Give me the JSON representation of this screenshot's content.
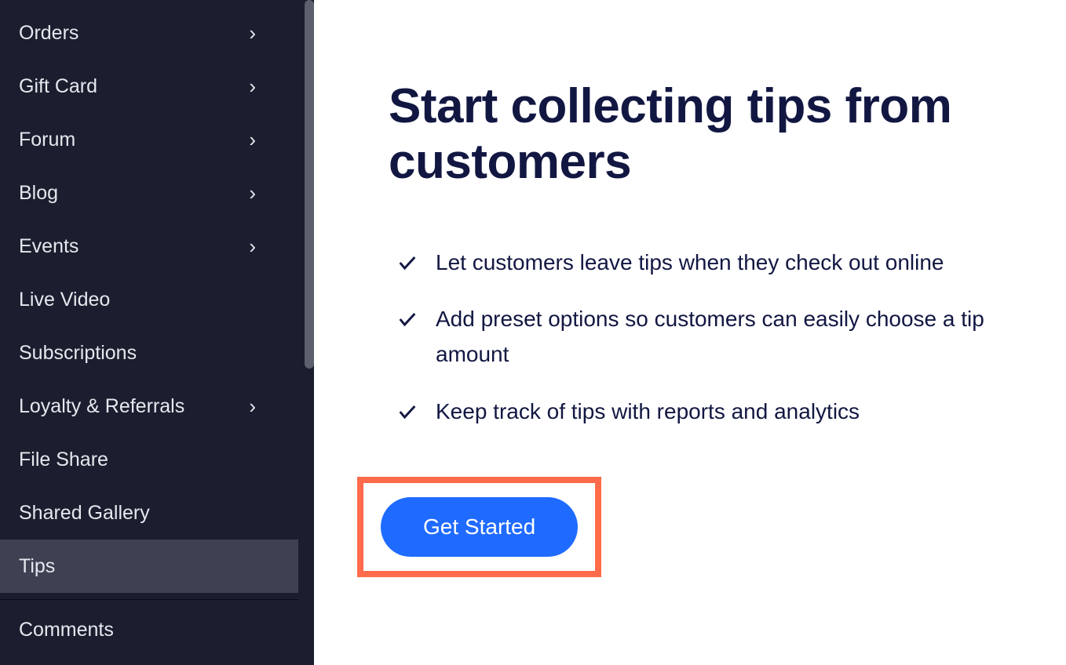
{
  "sidebar": {
    "items": [
      {
        "label": "Orders",
        "hasChildren": true
      },
      {
        "label": "Gift Card",
        "hasChildren": true
      },
      {
        "label": "Forum",
        "hasChildren": true
      },
      {
        "label": "Blog",
        "hasChildren": true
      },
      {
        "label": "Events",
        "hasChildren": true
      },
      {
        "label": "Live Video",
        "hasChildren": false
      },
      {
        "label": "Subscriptions",
        "hasChildren": false
      },
      {
        "label": "Loyalty & Referrals",
        "hasChildren": true
      },
      {
        "label": "File Share",
        "hasChildren": false
      },
      {
        "label": "Shared Gallery",
        "hasChildren": false
      },
      {
        "label": "Tips",
        "hasChildren": false,
        "active": true
      },
      {
        "label": "Comments",
        "hasChildren": false
      }
    ]
  },
  "main": {
    "title": "Start collecting tips from customers",
    "features": [
      "Let customers leave tips when they check out online",
      "Add preset options so customers can easily choose a tip amount",
      "Keep track of tips with reports and analytics"
    ],
    "cta_label": "Get Started"
  }
}
